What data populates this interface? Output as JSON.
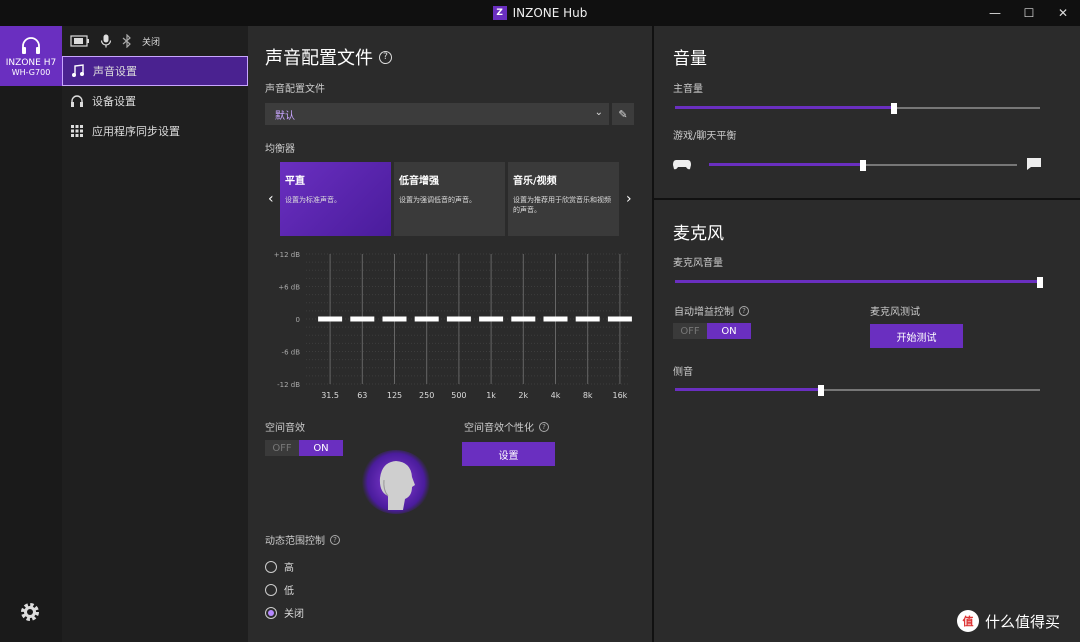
{
  "window": {
    "title": "INZONE Hub",
    "logo_glyph": "Z",
    "minimize": "—",
    "maximize": "☐",
    "close": "✕"
  },
  "device": {
    "name_line1": "INZONE H7",
    "name_line2": "WH-G700"
  },
  "status": {
    "bluetooth_state": "关闭"
  },
  "nav": {
    "items": [
      {
        "label": "声音设置",
        "icon": "music-note-icon",
        "active": true
      },
      {
        "label": "设备设置",
        "icon": "headphone-icon",
        "active": false
      },
      {
        "label": "应用程序同步设置",
        "icon": "grid-icon",
        "active": false
      }
    ]
  },
  "sound": {
    "title": "声音配置文件",
    "profile_label": "声音配置文件",
    "profile_value": "默认",
    "eq_label": "均衡器",
    "presets": [
      {
        "title": "平直",
        "desc": "设置为标准声音。"
      },
      {
        "title": "低音增强",
        "desc": "设置为强调低音的声音。"
      },
      {
        "title": "音乐/视频",
        "desc": "设置为推荐用于欣赏音乐和视频的声音。"
      }
    ],
    "spatial_label": "空间音效",
    "spatial_personal_label": "空间音效个性化",
    "settings_button": "设置",
    "drc_label": "动态范围控制",
    "drc_options": [
      {
        "label": "高",
        "selected": false
      },
      {
        "label": "低",
        "selected": false
      },
      {
        "label": "关闭",
        "selected": true
      }
    ],
    "toggle_off": "OFF",
    "toggle_on": "ON"
  },
  "chart_data": {
    "type": "bar",
    "categories": [
      "31.5",
      "63",
      "125",
      "250",
      "500",
      "1k",
      "2k",
      "4k",
      "8k",
      "16k"
    ],
    "values": [
      0,
      0,
      0,
      0,
      0,
      0,
      0,
      0,
      0,
      0
    ],
    "y_ticks": [
      "+12 dB",
      "+6 dB",
      "0",
      "-6 dB",
      "-12 dB"
    ],
    "ylim": [
      -12,
      12
    ],
    "grid": true
  },
  "volume": {
    "title": "音量",
    "master_label": "主音量",
    "master_value": 0.6,
    "balance_label": "游戏/聊天平衡",
    "balance_value": 0.5
  },
  "mic": {
    "title": "麦克风",
    "mic_volume_label": "麦克风音量",
    "mic_volume_value": 1.0,
    "agc_label": "自动增益控制",
    "mic_test_label": "麦克风测试",
    "mic_test_button": "开始测试",
    "sidetone_label": "侧音",
    "sidetone_value": 0.4
  },
  "watermark": {
    "logo_text": "值",
    "text": "什么值得买"
  },
  "colors": {
    "accent": "#6a2fc0",
    "accent_light": "#c9a6ff",
    "panel": "#2b2b2b"
  }
}
